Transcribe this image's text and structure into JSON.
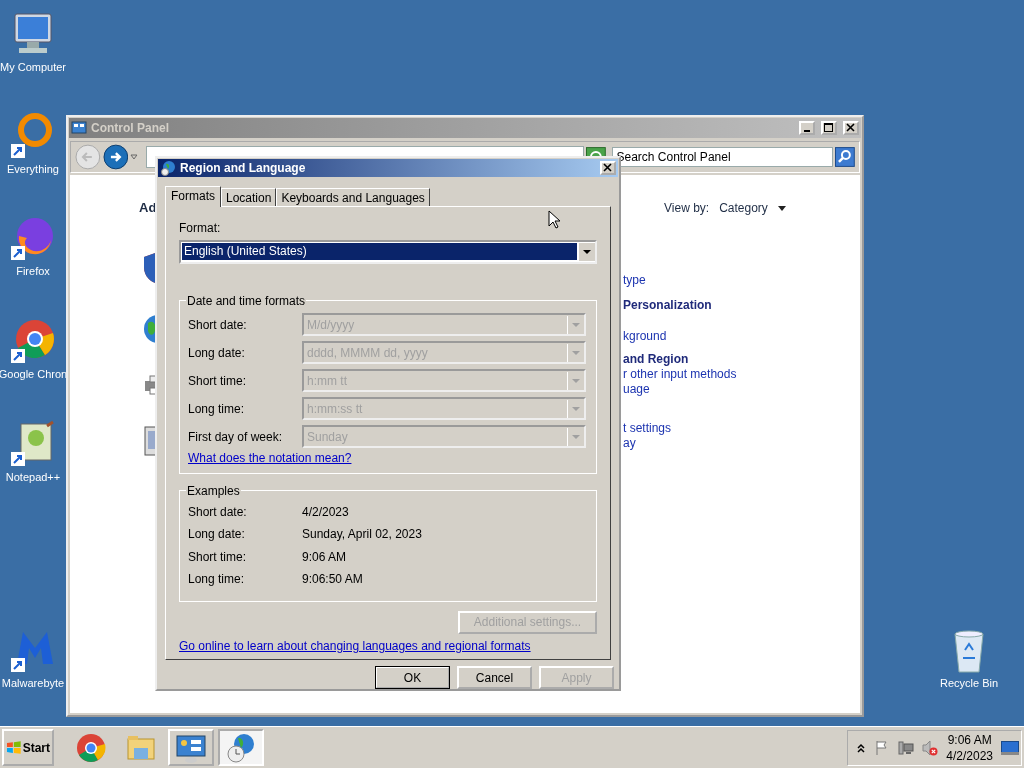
{
  "desktop_icons": [
    {
      "kind": "computer",
      "label": "My Computer"
    },
    {
      "kind": "everything",
      "label": "Everything"
    },
    {
      "kind": "firefox",
      "label": "Firefox"
    },
    {
      "kind": "chrome",
      "label": "Google Chron"
    },
    {
      "kind": "notepad",
      "label": "Notepad++"
    },
    {
      "kind": "malware",
      "label": "Malwarebyte"
    },
    {
      "kind": "recycle",
      "label": "Recycle Bin"
    }
  ],
  "control_panel": {
    "title": "Control Panel",
    "search": {
      "placeholder": "Search Control Panel"
    },
    "heading": "Ad",
    "view_by": {
      "label": "View by:",
      "value": "Category"
    },
    "groups": [
      [
        {
          "kind": "link",
          "text": "type"
        }
      ],
      [
        {
          "kind": "heading",
          "text": "Personalization"
        },
        {
          "kind": "link",
          "text": "kground"
        }
      ],
      [
        {
          "kind": "heading",
          "text": "and Region"
        },
        {
          "kind": "link",
          "text": "r other input methods"
        },
        {
          "kind": "link",
          "text": "uage"
        }
      ],
      [
        {
          "kind": "link",
          "text": "t settings"
        },
        {
          "kind": "link",
          "text": "ay"
        }
      ]
    ]
  },
  "dialog": {
    "title": "Region and Language",
    "tabs": [
      {
        "label": "Formats",
        "selected": true
      },
      {
        "label": "Location",
        "selected": false
      },
      {
        "label": "Keyboards and Languages",
        "selected": false
      }
    ],
    "format": {
      "label": "Format:",
      "value": "English (United States)"
    },
    "date_time_formats": {
      "title": "Date and time formats",
      "fields": [
        {
          "label": "Short date:",
          "value": "M/d/yyyy",
          "disabled": true
        },
        {
          "label": "Long date:",
          "value": "dddd, MMMM dd, yyyy",
          "disabled": true
        },
        {
          "label": "Short time:",
          "value": "h:mm tt",
          "disabled": true
        },
        {
          "label": "Long time:",
          "value": "h:mm:ss tt",
          "disabled": true
        },
        {
          "label": "First day of week:",
          "value": "Sunday",
          "disabled": true
        }
      ],
      "link": "What does the notation mean?"
    },
    "examples": {
      "title": "Examples",
      "rows": [
        {
          "label": "Short date:",
          "value": "4/2/2023"
        },
        {
          "label": "Long date:",
          "value": "Sunday, April 02, 2023"
        },
        {
          "label": "Short time:",
          "value": "9:06 AM"
        },
        {
          "label": "Long time:",
          "value": "9:06:50 AM"
        }
      ]
    },
    "additional_settings": {
      "label": "Additional settings...",
      "disabled": true
    },
    "online_link": "Go online to learn about changing languages and regional formats",
    "buttons": [
      {
        "label": "OK",
        "default": true,
        "disabled": false
      },
      {
        "label": "Cancel",
        "default": false,
        "disabled": false
      },
      {
        "label": "Apply",
        "default": false,
        "disabled": true
      }
    ]
  },
  "taskbar": {
    "start": "Start",
    "tasks": [
      {
        "kind": "chrome",
        "open": false,
        "selected": false
      },
      {
        "kind": "explorer",
        "open": false,
        "selected": false
      },
      {
        "kind": "control",
        "open": true,
        "selected": false
      },
      {
        "kind": "region",
        "open": true,
        "selected": true
      }
    ],
    "clock": {
      "time": "9:06 AM",
      "date": "4/2/2023"
    }
  }
}
